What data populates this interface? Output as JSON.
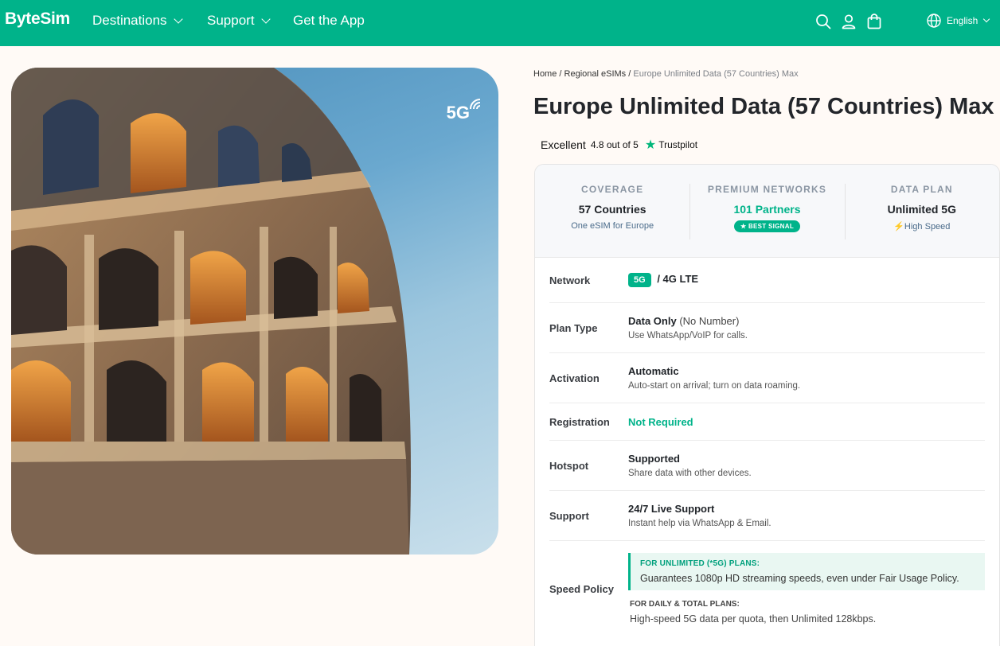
{
  "header": {
    "logo": "ByteSim",
    "nav": [
      {
        "label": "Destinations",
        "has_dropdown": true
      },
      {
        "label": "Support",
        "has_dropdown": true
      },
      {
        "label": "Get the App",
        "has_dropdown": false
      }
    ],
    "icons": [
      "search-icon",
      "user-icon",
      "bag-icon",
      "globe-icon"
    ],
    "language": "English",
    "accent_color": "#00b38a"
  },
  "hero": {
    "badge": "5G",
    "image": "colosseum photo"
  },
  "breadcrumb": {
    "items": [
      "Home",
      "Regional eSIMs"
    ],
    "separator": "/",
    "current": "Europe Unlimited Data (57 Countries) Max"
  },
  "product": {
    "title": "Europe Unlimited Data (57 Countries) Max"
  },
  "trustpilot": {
    "label": "Excellent",
    "rating": "4.8 out of 5",
    "brand": "Trustpilot"
  },
  "stats": [
    {
      "label": "COVERAGE",
      "value": "57 Countries",
      "sub": "One eSIM for Europe"
    },
    {
      "label": "PREMIUM NETWORKS",
      "value": "101 Partners",
      "sub": "★ BEST SIGNAL"
    },
    {
      "label": "DATA PLAN",
      "value": "Unlimited 5G",
      "sub": "High Speed"
    }
  ],
  "specs": {
    "network": {
      "label": "Network",
      "tag": "5G",
      "value": "/ 4G LTE"
    },
    "plan_type": {
      "label": "Plan Type",
      "value": "Data Only",
      "paren": "(No Number)",
      "desc": "Use WhatsApp/VoIP for calls."
    },
    "activation": {
      "label": "Activation",
      "value": "Automatic",
      "desc": "Auto-start on arrival; turn on data roaming."
    },
    "registration": {
      "label": "Registration",
      "value": "Not Required"
    },
    "hotspot": {
      "label": "Hotspot",
      "value": "Supported",
      "desc": "Share data with other devices."
    },
    "support": {
      "label": "Support",
      "value": "24/7 Live Support",
      "desc": "Instant help via WhatsApp & Email."
    },
    "speed_policy": {
      "label": "Speed Policy",
      "unlimited_heading": "FOR UNLIMITED (*5G) PLANS:",
      "unlimited_text": "Guarantees 1080p HD streaming speeds, even under Fair Usage Policy.",
      "daily_heading": "FOR DAILY & TOTAL PLANS:",
      "daily_text": "High-speed 5G data per quota, then Unlimited 128kbps."
    }
  }
}
